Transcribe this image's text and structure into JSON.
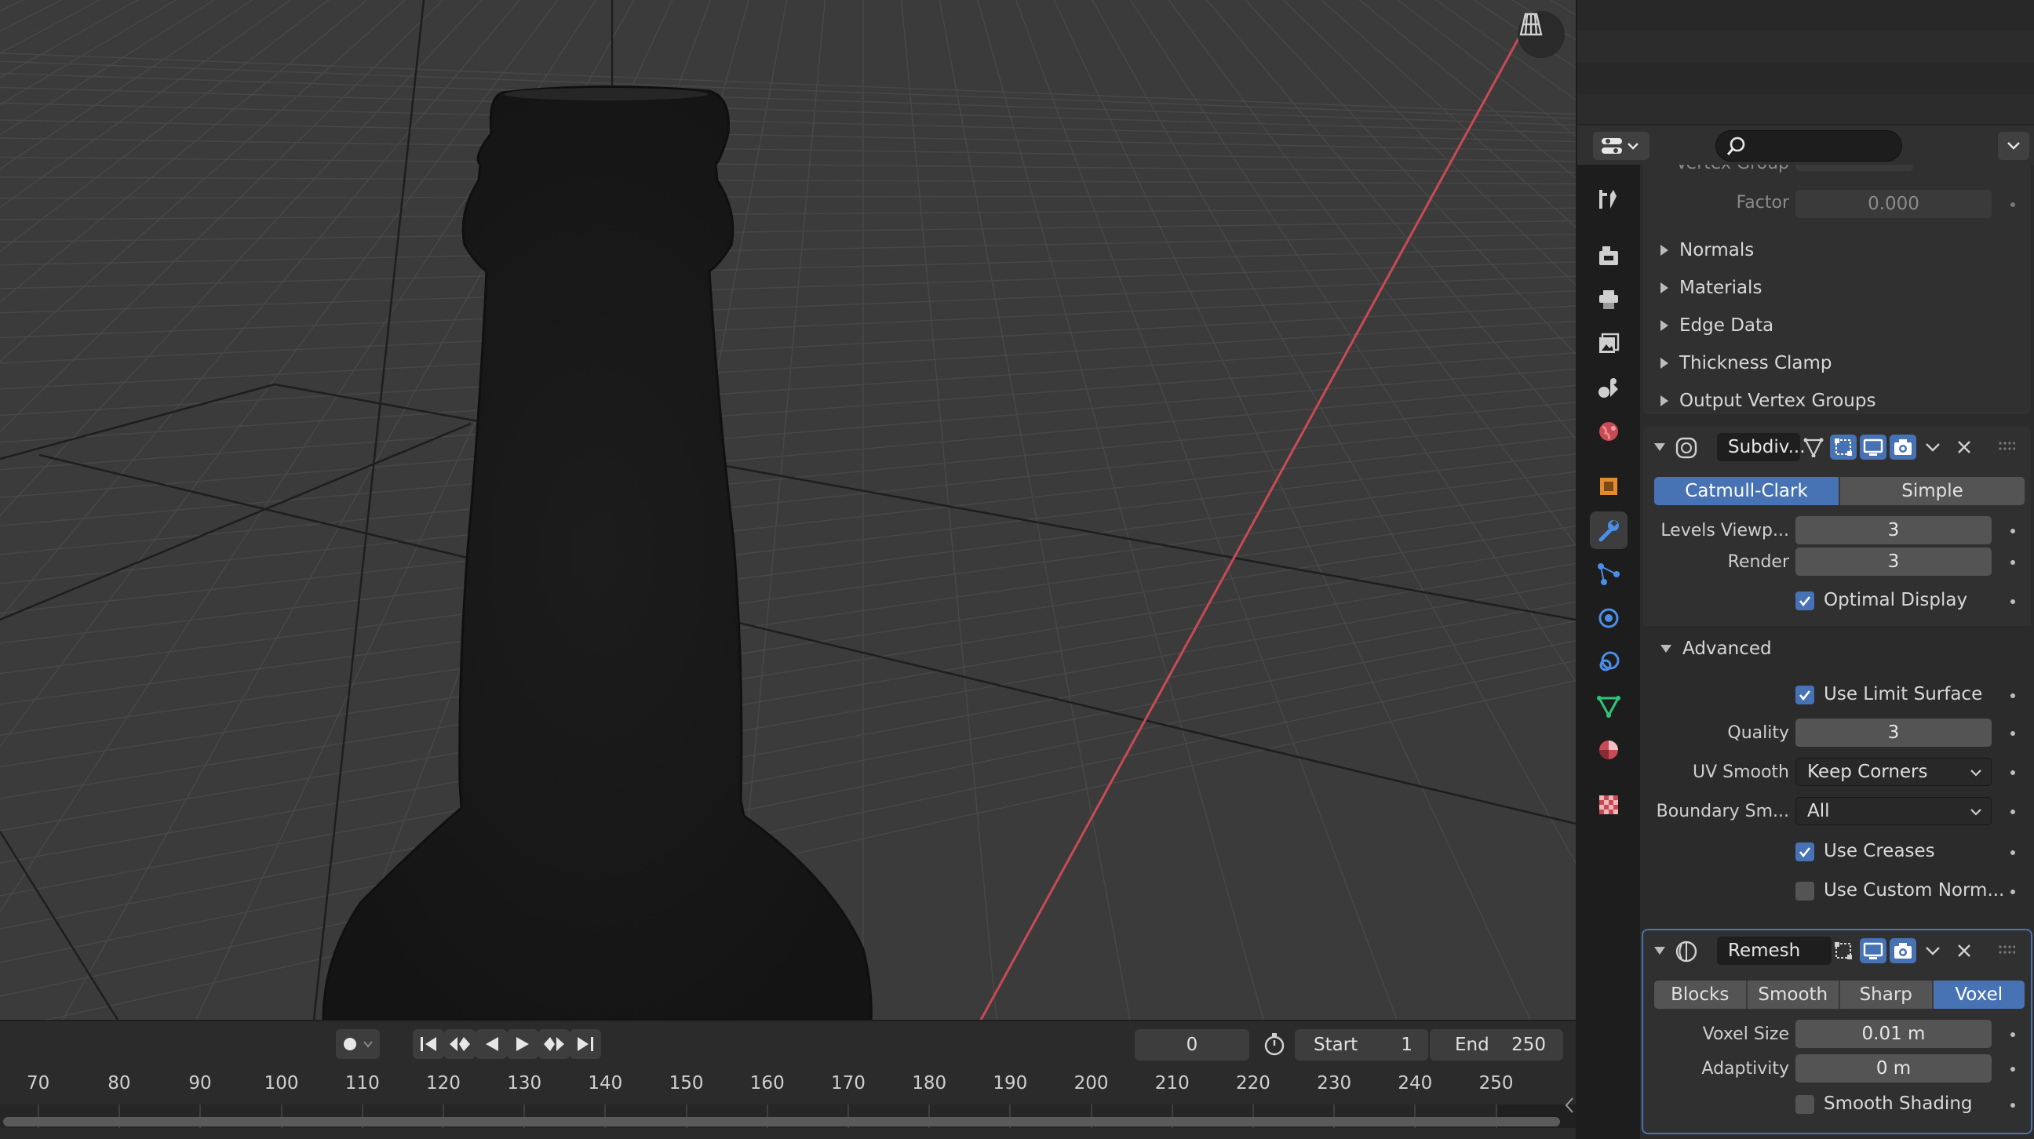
{
  "viewport": {
    "name": "3D Viewport"
  },
  "timeline": {
    "current_frame": "0",
    "start_label": "Start",
    "start_value": "1",
    "end_label": "End",
    "end_value": "250",
    "ruler_ticks": [
      "70",
      "80",
      "90",
      "100",
      "110",
      "120",
      "130",
      "140",
      "150",
      "160",
      "170",
      "180",
      "190",
      "200",
      "210",
      "220",
      "230",
      "240",
      "250"
    ]
  },
  "properties": {
    "search_placeholder": "",
    "solidify": {
      "vertex_group_label": "Vertex Group",
      "factor_label": "Factor",
      "factor_value": "0.000",
      "subpanels": [
        "Normals",
        "Materials",
        "Edge Data",
        "Thickness Clamp",
        "Output Vertex Groups"
      ]
    },
    "subdivision": {
      "name": "Subdiv...",
      "modes": [
        "Catmull-Clark",
        "Simple"
      ],
      "active_mode": "Catmull-Clark",
      "levels_viewport_label": "Levels Viewp...",
      "levels_viewport_value": "3",
      "render_label": "Render",
      "render_value": "3",
      "optimal_display_label": "Optimal Display",
      "optimal_display": true,
      "advanced_label": "Advanced",
      "use_limit_surface_label": "Use Limit Surface",
      "use_limit_surface": true,
      "quality_label": "Quality",
      "quality_value": "3",
      "uv_smooth_label": "UV Smooth",
      "uv_smooth_value": "Keep Corners",
      "boundary_smooth_label": "Boundary Sm...",
      "boundary_smooth_value": "All",
      "use_creases_label": "Use Creases",
      "use_creases": true,
      "use_custom_normals_label": "Use Custom Norm...",
      "use_custom_normals": false
    },
    "remesh": {
      "name": "Remesh",
      "modes": [
        "Blocks",
        "Smooth",
        "Sharp",
        "Voxel"
      ],
      "active_mode": "Voxel",
      "voxel_size_label": "Voxel Size",
      "voxel_size_value": "0.01 m",
      "adaptivity_label": "Adaptivity",
      "adaptivity_value": "0 m",
      "smooth_shading_label": "Smooth Shading",
      "smooth_shading": false
    }
  },
  "colors": {
    "accent": "#4772b3",
    "viewport_bg": "#3b3b3b",
    "x_axis": "#c84a55"
  }
}
